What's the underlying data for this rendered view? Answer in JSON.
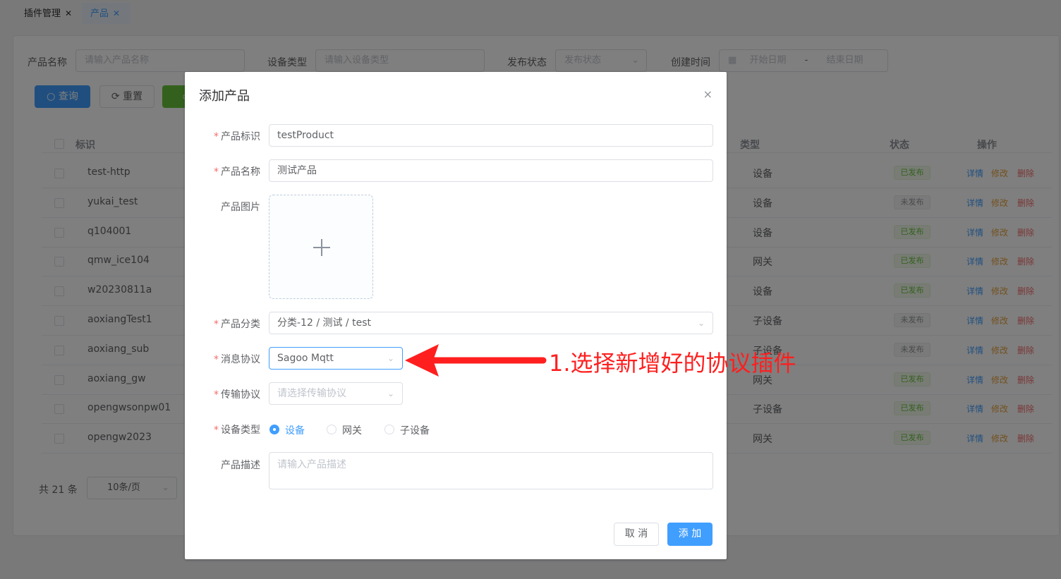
{
  "tabs": [
    {
      "label": "插件管理",
      "close": "✕"
    },
    {
      "label": "产品",
      "close": "✕"
    }
  ],
  "filters": {
    "product_name_label": "产品名称",
    "product_name_placeholder": "请输入产品名称",
    "device_type_label": "设备类型",
    "device_type_placeholder": "请输入设备类型",
    "publish_status_label": "发布状态",
    "publish_status_placeholder": "发布状态",
    "created_time_label": "创建时间",
    "start_date": "开始日期",
    "date_sep": "-",
    "end_date": "结束日期"
  },
  "actions": {
    "query": "查询",
    "reset": "重置"
  },
  "table": {
    "headers": {
      "id": "标识",
      "type": "类型",
      "status": "状态",
      "ops": "操作"
    },
    "op_labels": {
      "detail": "详情",
      "edit": "修改",
      "delete": "删除"
    },
    "rows": [
      {
        "id": "test-http",
        "type": "设备",
        "status": "已发布"
      },
      {
        "id": "yukai_test",
        "type": "设备",
        "status": "未发布"
      },
      {
        "id": "q104001",
        "type": "设备",
        "status": "已发布"
      },
      {
        "id": "qmw_ice104",
        "type": "网关",
        "status": "已发布"
      },
      {
        "id": "w20230811a",
        "type": "设备",
        "status": "已发布"
      },
      {
        "id": "aoxiangTest1",
        "type": "子设备",
        "status": "未发布"
      },
      {
        "id": "aoxiang_sub",
        "type": "子设备",
        "status": "未发布"
      },
      {
        "id": "aoxiang_gw",
        "type": "网关",
        "status": "已发布"
      },
      {
        "id": "opengwsonpw01",
        "type": "子设备",
        "status": "已发布"
      },
      {
        "id": "opengw2023",
        "type": "网关",
        "status": "已发布"
      }
    ]
  },
  "pagination": {
    "total": "共 21 条",
    "page_size": "10条/页"
  },
  "dialog": {
    "title": "添加产品",
    "close": "×",
    "required_mark": "*",
    "fields": {
      "product_key_label": "产品标识",
      "product_key_value": "testProduct",
      "product_name_label": "产品名称",
      "product_name_value": "测试产品",
      "product_image_label": "产品图片",
      "category_label": "产品分类",
      "category_value": "分类-12 / 测试 / test",
      "message_protocol_label": "消息协议",
      "message_protocol_value": "Sagoo Mqtt",
      "transport_protocol_label": "传输协议",
      "transport_protocol_placeholder": "请选择传输协议",
      "device_type_label": "设备类型",
      "device_type_options": [
        "设备",
        "网关",
        "子设备"
      ],
      "description_label": "产品描述",
      "description_placeholder": "请输入产品描述"
    },
    "cancel": "取 消",
    "submit": "添 加"
  },
  "annotation": {
    "text": "1.选择新增好的协议插件",
    "color": "#ff1f1f"
  },
  "colors": {
    "primary": "#409eff",
    "success": "#67c23a",
    "danger": "#f56c6c",
    "warning": "#e6a23c"
  }
}
